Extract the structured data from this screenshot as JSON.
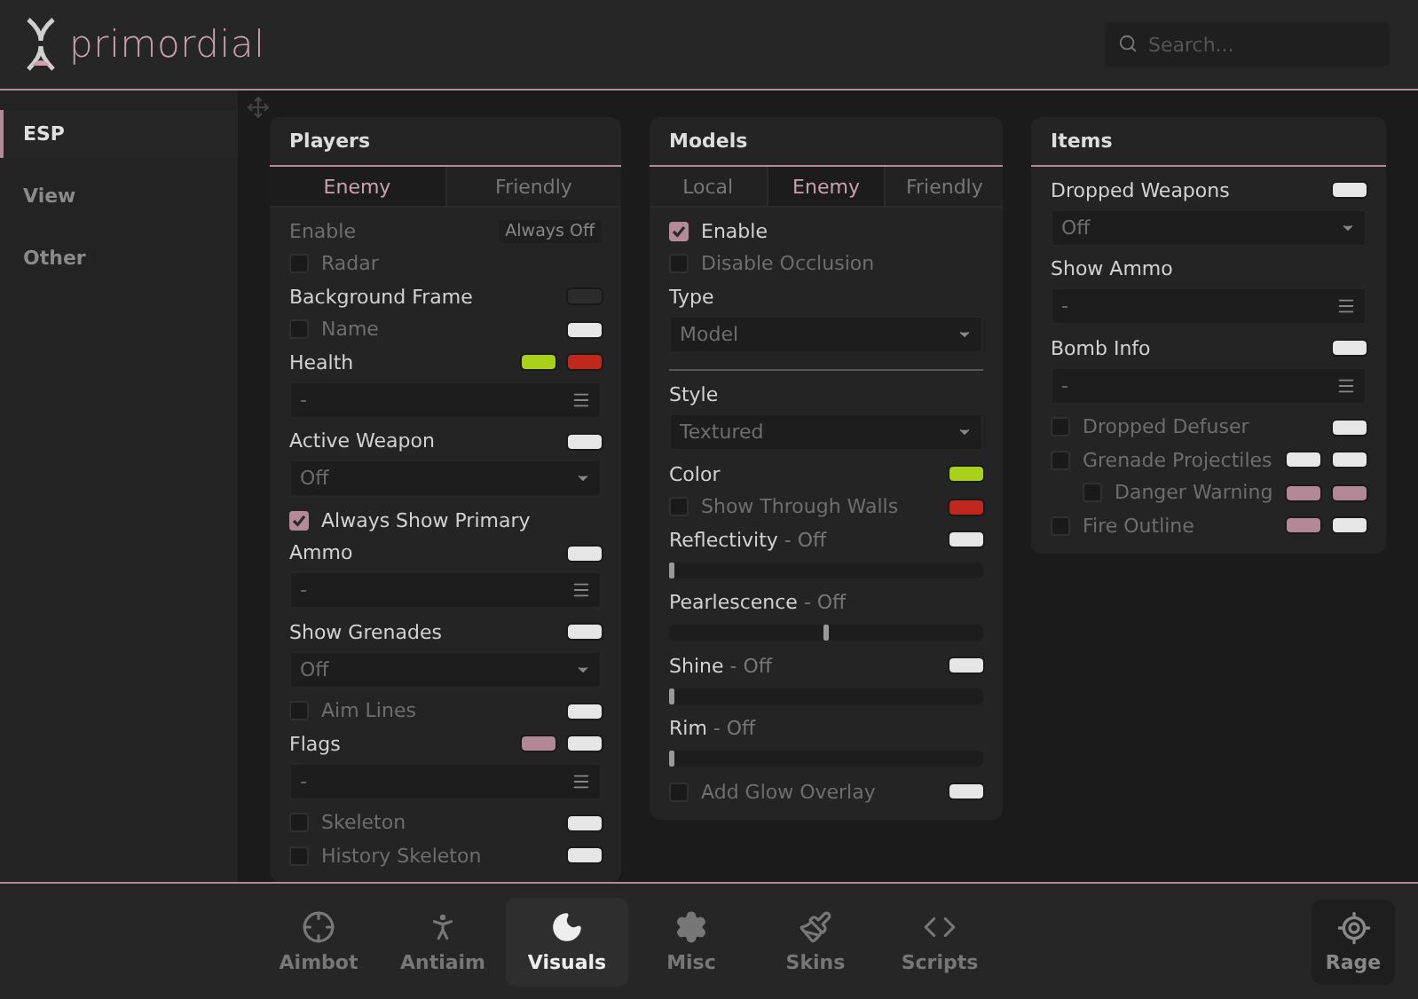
{
  "header": {
    "logo": "primordial",
    "search": {
      "placeholder": "Search..."
    }
  },
  "sidebar": {
    "items": [
      {
        "label": "ESP",
        "selected": true
      },
      {
        "label": "View",
        "selected": false
      },
      {
        "label": "Other",
        "selected": false
      }
    ]
  },
  "panels": [
    {
      "title": "Players",
      "tabs": [
        {
          "label": "Enemy",
          "selected": true
        },
        {
          "label": "Friendly",
          "selected": false
        }
      ],
      "rows": [
        {
          "kind": "keybind",
          "label": "Enable",
          "badge": "Always Off"
        },
        {
          "kind": "check",
          "label": "Radar",
          "checked": false
        },
        {
          "kind": "label",
          "label": "Background Frame",
          "swatches": [
            {
              "color": "#2c2c2c"
            }
          ]
        },
        {
          "kind": "check",
          "label": "Name",
          "checked": false,
          "swatches": [
            {
              "color": "#e6e6e6"
            }
          ]
        },
        {
          "kind": "label",
          "label": "Health",
          "swatches": [
            {
              "color": "#a9d11c"
            },
            {
              "color": "#c0281e"
            }
          ]
        },
        {
          "kind": "multi",
          "value": "-"
        },
        {
          "kind": "label",
          "label": "Active Weapon",
          "swatches": [
            {
              "color": "#e6e6e6"
            }
          ]
        },
        {
          "kind": "select",
          "value": "Off"
        },
        {
          "kind": "check",
          "label": "Always Show Primary",
          "checked": true
        },
        {
          "kind": "label",
          "label": "Ammo",
          "swatches": [
            {
              "color": "#e6e6e6"
            }
          ]
        },
        {
          "kind": "multi",
          "value": "-"
        },
        {
          "kind": "label",
          "label": "Show Grenades",
          "swatches": [
            {
              "color": "#e6e6e6"
            }
          ]
        },
        {
          "kind": "select",
          "value": "Off"
        },
        {
          "kind": "check",
          "label": "Aim Lines",
          "checked": false,
          "swatches": [
            {
              "color": "#e6e6e6"
            }
          ]
        },
        {
          "kind": "label",
          "label": "Flags",
          "swatches": [
            {
              "color": "#b38896"
            },
            {
              "color": "#e6e6e6"
            }
          ]
        },
        {
          "kind": "multi",
          "value": "-"
        },
        {
          "kind": "check",
          "label": "Skeleton",
          "checked": false,
          "swatches": [
            {
              "color": "#e6e6e6"
            }
          ]
        },
        {
          "kind": "check",
          "label": "History Skeleton",
          "checked": false,
          "swatches": [
            {
              "color": "#e6e6e6"
            }
          ]
        }
      ]
    },
    {
      "title": "Models",
      "tabs": [
        {
          "label": "Local",
          "selected": false
        },
        {
          "label": "Enemy",
          "selected": true
        },
        {
          "label": "Friendly",
          "selected": false
        }
      ],
      "rows": [
        {
          "kind": "check",
          "label": "Enable",
          "checked": true
        },
        {
          "kind": "check",
          "label": "Disable Occlusion",
          "checked": false
        },
        {
          "kind": "label",
          "label": "Type"
        },
        {
          "kind": "select",
          "value": "Model"
        },
        {
          "kind": "divider"
        },
        {
          "kind": "label",
          "label": "Style"
        },
        {
          "kind": "select",
          "value": "Textured"
        },
        {
          "kind": "label",
          "label": "Color",
          "swatches": [
            {
              "color": "#a9d11c"
            }
          ]
        },
        {
          "kind": "check",
          "label": "Show Through Walls",
          "checked": false,
          "swatches": [
            {
              "color": "#c0281e"
            }
          ]
        },
        {
          "kind": "slider",
          "label": "Reflectivity",
          "suffix": "- Off",
          "level": 0,
          "swatches": [
            {
              "color": "#e6e6e6"
            }
          ]
        },
        {
          "kind": "slider",
          "label": "Pearlescence",
          "suffix": "- Off",
          "level": 0.5
        },
        {
          "kind": "slider",
          "label": "Shine",
          "suffix": "- Off",
          "level": 0,
          "swatches": [
            {
              "color": "#e6e6e6"
            }
          ]
        },
        {
          "kind": "slider",
          "label": "Rim",
          "suffix": "- Off",
          "level": 0
        },
        {
          "kind": "check",
          "label": "Add Glow Overlay",
          "checked": false,
          "swatches": [
            {
              "color": "#e6e6e6"
            }
          ]
        }
      ]
    },
    {
      "title": "Items",
      "rows": [
        {
          "kind": "label",
          "label": "Dropped Weapons",
          "swatches": [
            {
              "color": "#e6e6e6"
            }
          ]
        },
        {
          "kind": "select",
          "value": "Off"
        },
        {
          "kind": "label",
          "label": "Show Ammo"
        },
        {
          "kind": "multi",
          "value": "-"
        },
        {
          "kind": "label",
          "label": "Bomb Info",
          "swatches": [
            {
              "color": "#e6e6e6"
            }
          ]
        },
        {
          "kind": "multi",
          "value": "-"
        },
        {
          "kind": "check",
          "label": "Dropped Defuser",
          "checked": false,
          "swatches": [
            {
              "color": "#e6e6e6"
            }
          ]
        },
        {
          "kind": "check",
          "label": "Grenade Projectiles",
          "checked": false,
          "swatches": [
            {
              "color": "#e6e6e6"
            },
            {
              "color": "#e6e6e6"
            }
          ],
          "children": [
            {
              "kind": "check",
              "label": "Danger Warning",
              "checked": false,
              "swatches": [
                {
                  "color": "#b38896"
                },
                {
                  "color": "#b38896"
                }
              ]
            }
          ]
        },
        {
          "kind": "check",
          "label": "Fire Outline",
          "checked": false,
          "swatches": [
            {
              "color": "#b38896"
            },
            {
              "color": "#e6e6e6"
            }
          ]
        }
      ]
    }
  ],
  "bottom_nav": {
    "items": [
      {
        "label": "Aimbot",
        "selected": false
      },
      {
        "label": "Antiaim",
        "selected": false
      },
      {
        "label": "Visuals",
        "selected": true
      },
      {
        "label": "Misc",
        "selected": false
      },
      {
        "label": "Skins",
        "selected": false
      },
      {
        "label": "Scripts",
        "selected": false
      }
    ],
    "rage_button": {
      "label": "Rage"
    }
  }
}
